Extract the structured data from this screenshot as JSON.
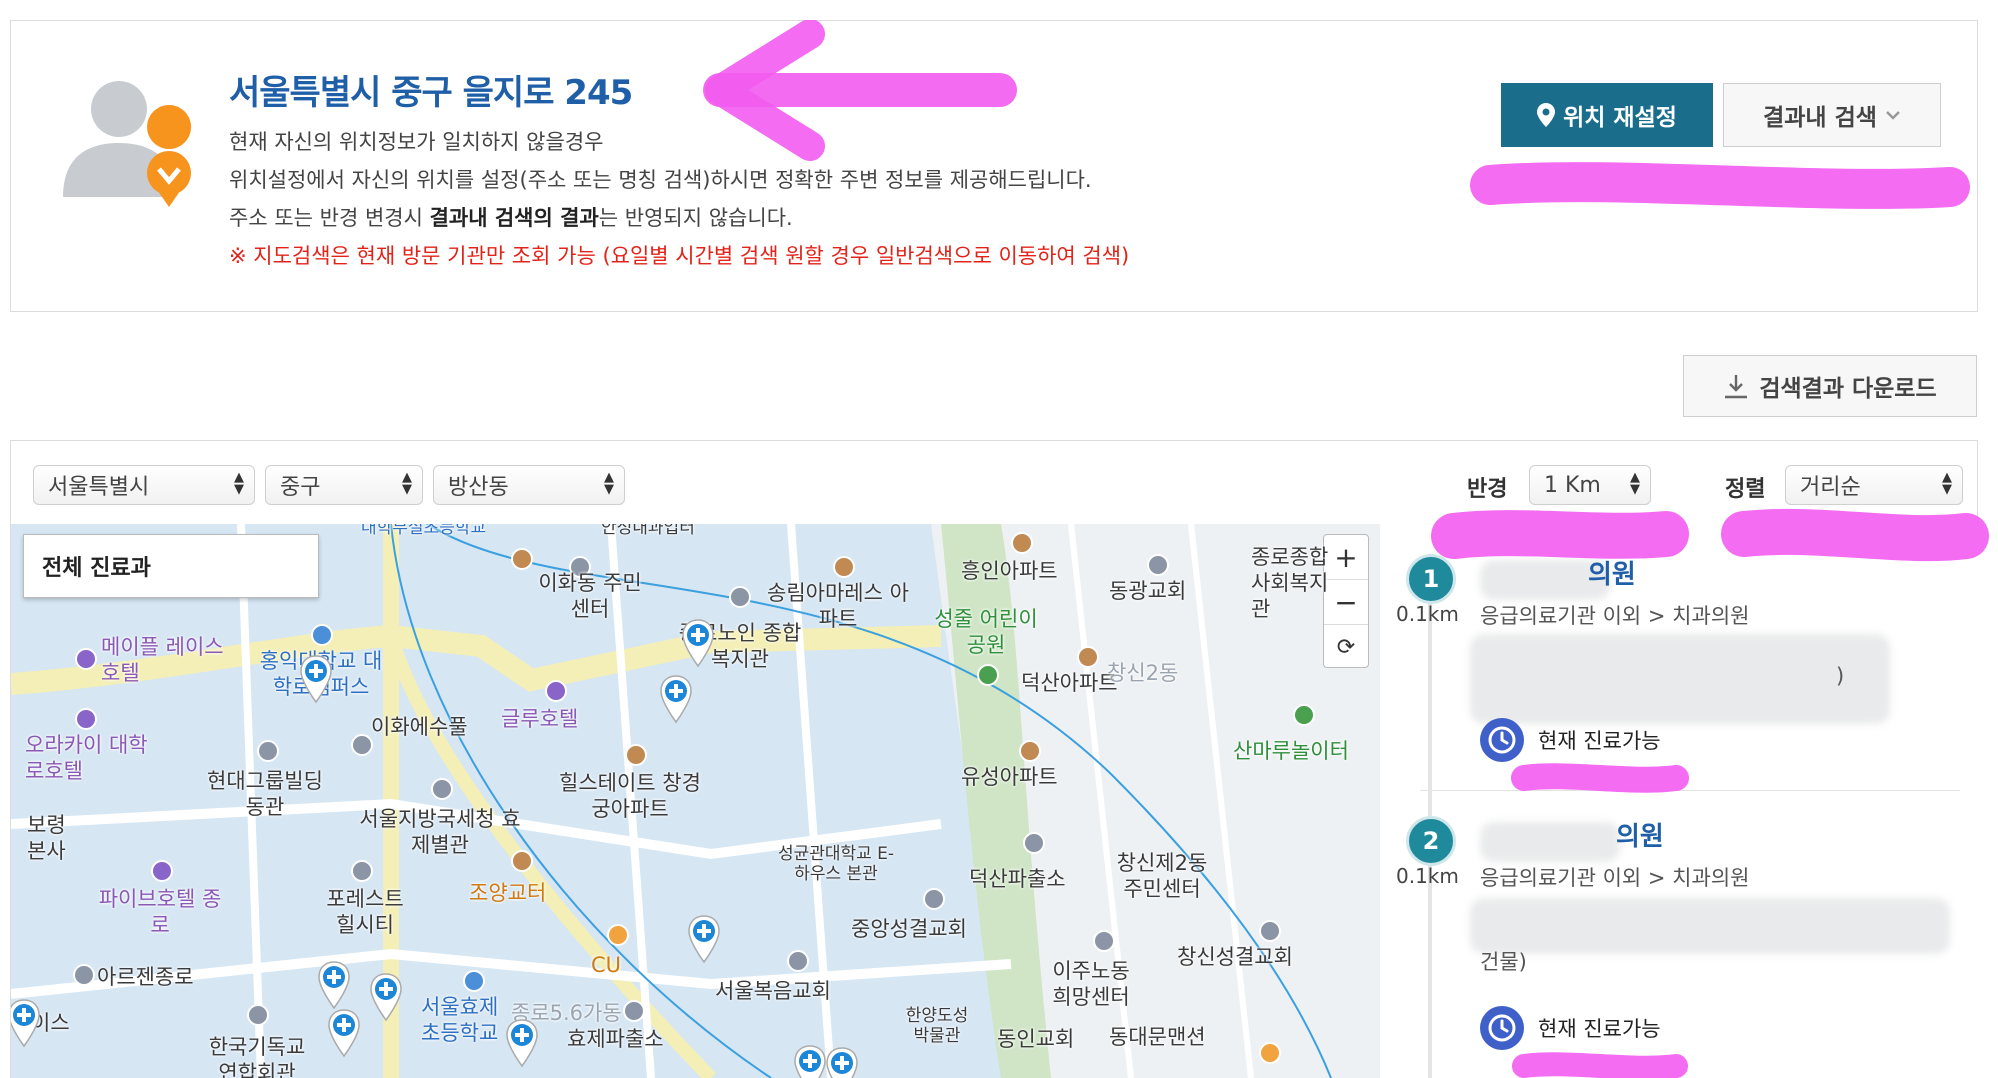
{
  "location": {
    "address": "서울특별시 중구 을지로 245",
    "desc_line1": "현재 자신의 위치정보가 일치하지 않을경우",
    "desc_line2": "위치설정에서 자신의 위치를 설정(주소 또는 명칭 검색)하시면 정확한 주변 정보를 제공해드립니다.",
    "desc_line3_pre": "주소 또는 반경 변경시 ",
    "desc_line3_bold": "결과내 검색의 결과",
    "desc_line3_post": "는 반영되지 않습니다.",
    "warning": "※ 지도검색은 현재 방문 기관만 조회 가능 (요일별 시간별 검색 원할 경우 일반검색으로 이동하여 검색)",
    "reset_button": "위치 재설정",
    "insearch_button": "결과내 검색"
  },
  "download_button": "검색결과 다운로드",
  "filters": {
    "city": "서울특별시",
    "district": "중구",
    "dong": "방산동",
    "radius_label": "반경",
    "radius_value": "1 Km",
    "sort_label": "정렬",
    "sort_value": "거리순"
  },
  "map": {
    "department_box": "전체 진료과",
    "labels": [
      "대학부설초등학교",
      "안성내과업터",
      "이화동 주민센터",
      "송림아마레스 아파트",
      "종로노인 종합복지관",
      "흥인아파트",
      "동광교회",
      "종로종합 사회복지관",
      "메이플 레이스호텔",
      "홍익대학교 대학로캠퍼스",
      "성줄 어린이공원",
      "덕산아파트",
      "오라카이 대학로호텔",
      "이화에수풀",
      "글루호텔",
      "산마루놀이터",
      "현대그룹빌딩 동관",
      "힐스테이트 창경궁아파트",
      "유성아파트",
      "보령 본사",
      "서울지방국세청 효제별관",
      "성균관대학교 E-하우스 본관",
      "덕산파출소",
      "창신제2동 주민센터",
      "파이브호텔 종로",
      "포레스트 힐시티",
      "조양교터",
      "중앙성결교회",
      "아르젠종로",
      "CU",
      "이주노동 희망센터",
      "창신성결교회",
      "서울효제 초등학교",
      "종로5.6가동",
      "서울복음교회",
      "한양도성 박물관",
      "동인교회",
      "동대문맨션",
      "한국기독교 연합회관",
      "효제파출소",
      "이스",
      "창신2동"
    ]
  },
  "results": [
    {
      "number": "1",
      "distance": "0.1km",
      "name_suffix": "의원",
      "category": "응급의료기관 이외 > 치과의원",
      "address_tail": ")",
      "status": "현재 진료가능"
    },
    {
      "number": "2",
      "distance": "0.1km",
      "name_suffix": "의원",
      "category": "응급의료기관 이외 > 치과의원",
      "address_tail": "건물)",
      "status": "현재 진료가능"
    }
  ],
  "colors": {
    "primary": "#1a6e8c",
    "title_blue": "#1f5fa8",
    "warning_red": "#e2231a",
    "annotation_pink": "#f25cf0"
  },
  "icons": [
    "user-avatar-icon",
    "location-pin-icon",
    "chevron-down-icon",
    "download-icon",
    "clock-icon",
    "plus-icon",
    "minus-icon",
    "refresh-icon",
    "hospital-pin-icon"
  ]
}
